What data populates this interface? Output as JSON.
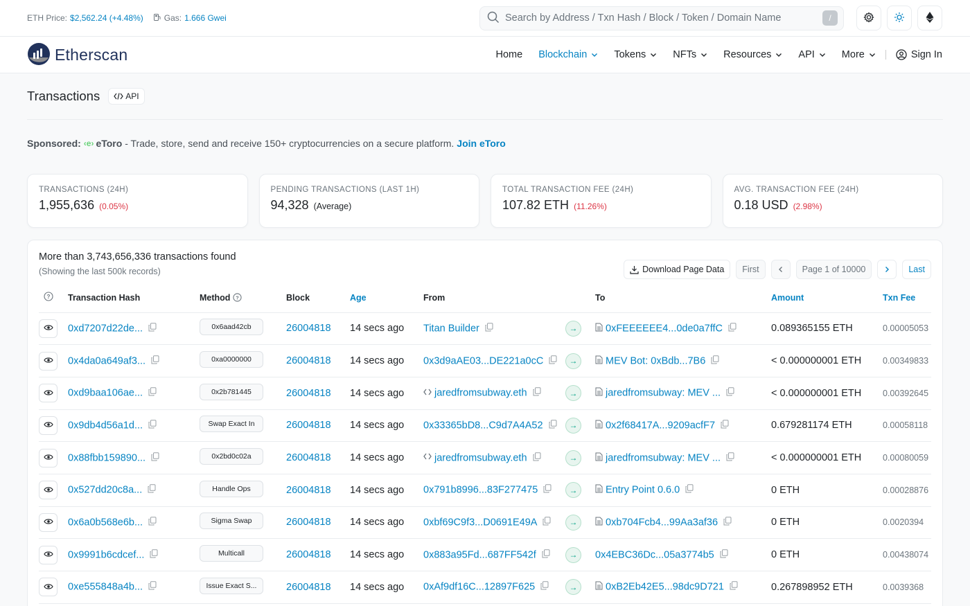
{
  "topbar": {
    "eth_price_label": "ETH Price:",
    "eth_price_value": "$2,562.24 (+4.48%)",
    "gas_label": "Gas:",
    "gas_value": "1.666 Gwei",
    "search_placeholder": "Search by Address / Txn Hash / Block / Token / Domain Name",
    "search_shortcut": "/"
  },
  "header": {
    "logo_text": "Etherscan",
    "nav": [
      "Home",
      "Blockchain",
      "Tokens",
      "NFTs",
      "Resources",
      "API",
      "More"
    ],
    "signin": "Sign In"
  },
  "page": {
    "title": "Transactions",
    "api_badge": "API"
  },
  "sponsored": {
    "label": "Sponsored:",
    "brand": "eToro",
    "text": " - Trade, store, send and receive 150+ cryptocurrencies on a secure platform.",
    "cta": "Join eToro"
  },
  "stats": [
    {
      "label": "TRANSACTIONS (24H)",
      "value": "1,955,636",
      "change": "(0.05%)"
    },
    {
      "label": "PENDING TRANSACTIONS (LAST 1H)",
      "value": "94,328",
      "note": "(Average)"
    },
    {
      "label": "TOTAL TRANSACTION FEE (24H)",
      "value": "107.82 ETH",
      "change": "(11.26%)"
    },
    {
      "label": "AVG. TRANSACTION FEE (24H)",
      "value": "0.18 USD",
      "change": "(2.98%)"
    }
  ],
  "panel": {
    "count_text": "More than 3,743,656,336 transactions found",
    "sub_text": "(Showing the last 500k records)",
    "download": "Download Page Data",
    "first": "First",
    "page_text": "Page 1 of 10000",
    "last": "Last"
  },
  "table": {
    "headers": [
      "Transaction Hash",
      "Method",
      "Block",
      "Age",
      "From",
      "To",
      "Amount",
      "Txn Fee"
    ],
    "rows": [
      {
        "hash": "0xd7207d22de...",
        "method": "0x6aad42cb",
        "block": "26004818",
        "age": "14 secs ago",
        "from": "Titan Builder",
        "from_type": "plain",
        "to": "0xFEEEEEE4...0de0a7ffC",
        "to_contract": true,
        "amount": "0.089365155 ETH",
        "fee": "0.00005053"
      },
      {
        "hash": "0x4da0a649af3...",
        "method": "0xa0000000",
        "block": "26004818",
        "age": "14 secs ago",
        "from": "0x3d9aAE03...DE221a0cC",
        "from_type": "plain",
        "to": "MEV Bot: 0xBdb...7B6",
        "to_contract": true,
        "amount": "< 0.000000001 ETH",
        "fee": "0.00349833"
      },
      {
        "hash": "0xd9baa106ae...",
        "method": "0x2b781445",
        "block": "26004818",
        "age": "14 secs ago",
        "from": "jaredfromsubway.eth",
        "from_type": "ens",
        "to": "jaredfromsubway: MEV ...",
        "to_contract": true,
        "amount": "< 0.000000001 ETH",
        "fee": "0.00392645"
      },
      {
        "hash": "0x9db4d56a1d...",
        "method": "Swap Exact In",
        "block": "26004818",
        "age": "14 secs ago",
        "from": "0x33365bD8...C9d7A4A52",
        "from_type": "plain",
        "to": "0x2f68417A...9209acfF7",
        "to_contract": true,
        "amount": "0.679281174 ETH",
        "fee": "0.00058118"
      },
      {
        "hash": "0x88fbb159890...",
        "method": "0x2bd0c02a",
        "block": "26004818",
        "age": "14 secs ago",
        "from": "jaredfromsubway.eth",
        "from_type": "ens",
        "to": "jaredfromsubway: MEV ...",
        "to_contract": true,
        "amount": "< 0.000000001 ETH",
        "fee": "0.00080059"
      },
      {
        "hash": "0x527dd20c8a...",
        "method": "Handle Ops",
        "block": "26004818",
        "age": "14 secs ago",
        "from": "0x791b8996...83F277475",
        "from_type": "plain",
        "to": "Entry Point 0.6.0",
        "to_contract": true,
        "amount": "0 ETH",
        "fee": "0.00028876"
      },
      {
        "hash": "0x6a0b568e6b...",
        "method": "Sigma Swap",
        "block": "26004818",
        "age": "14 secs ago",
        "from": "0xbf69C9f3...D0691E49A",
        "from_type": "plain",
        "to": "0xb704Fcb4...99Aa3af36",
        "to_contract": true,
        "amount": "0 ETH",
        "fee": "0.0020394"
      },
      {
        "hash": "0x9991b6cdcef...",
        "method": "Multicall",
        "block": "26004818",
        "age": "14 secs ago",
        "from": "0x883a95Fd...687FF542f",
        "from_type": "plain",
        "to": "0x4EBC36Dc...05a3774b5",
        "to_contract": false,
        "amount": "0 ETH",
        "fee": "0.00438074"
      },
      {
        "hash": "0xe555848a4b...",
        "method": "Issue Exact S...",
        "block": "26004818",
        "age": "14 secs ago",
        "from": "0xAf9df16C...12897F625",
        "from_type": "plain",
        "to": "0xB2Eb42E5...98dc9D721",
        "to_contract": true,
        "amount": "0.267898952 ETH",
        "fee": "0.0039368"
      }
    ]
  },
  "colors": {
    "link": "#0784c3",
    "negative": "#dc3545",
    "muted": "#6c757d",
    "arrow_green": "#00a186"
  },
  "icons": {
    "search": "search-icon",
    "settings": "gear-icon",
    "theme": "sun-icon",
    "eth": "ethereum-icon"
  }
}
